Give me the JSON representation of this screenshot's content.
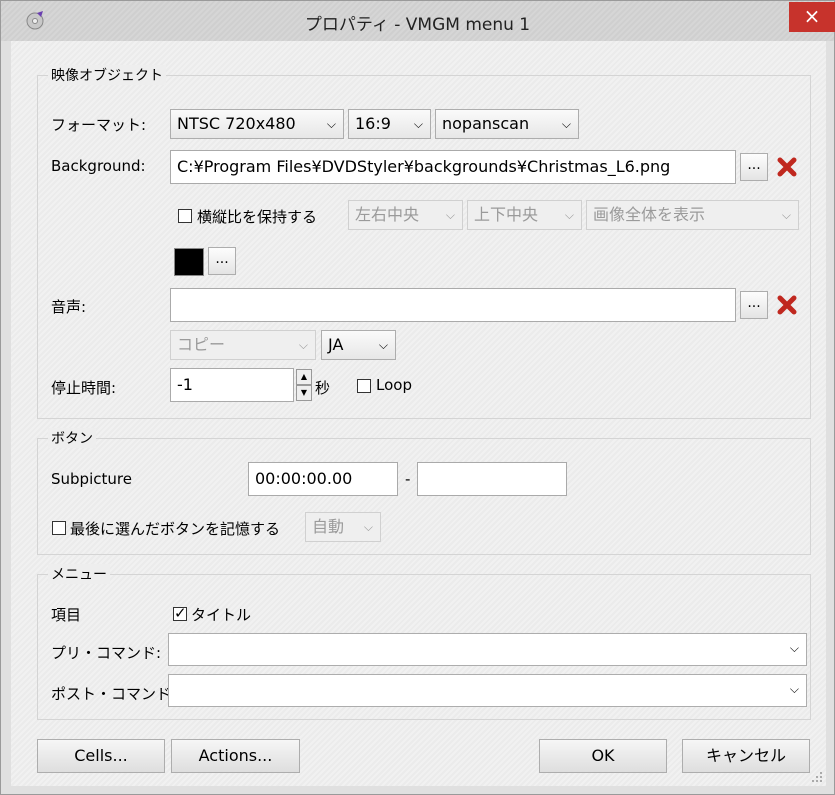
{
  "window": {
    "title": "プロパティ - VMGM menu 1",
    "close": "×"
  },
  "video": {
    "group_title": "映像オブジェクト",
    "format_label": "フォーマット:",
    "format_value": "NTSC 720x480",
    "aspect_value": "16:9",
    "scan_value": "nopanscan",
    "background_label": "Background:",
    "background_value": "C:¥Program Files¥DVDStyler¥backgrounds¥Christmas_L6.png",
    "browse_label": "...",
    "keep_aspect_label": "横縦比を保持する",
    "halign_value": "左右中央",
    "valign_value": "上下中央",
    "fit_value": "画像全体を表示",
    "color_value": "#000000",
    "audio_label": "音声:",
    "audio_value": "",
    "copy_value": "コピー",
    "lang_value": "JA",
    "pause_label": "停止時間:",
    "pause_value": "-1",
    "seconds_label": "秒",
    "loop_label": "Loop"
  },
  "buttons": {
    "group_title": "ボタン",
    "subpicture_label": "Subpicture",
    "start_value": "00:00:00.00",
    "dash": "-",
    "end_value": "",
    "remember_label": "最後に選んだボタンを記憶する",
    "auto_value": "自動"
  },
  "menu": {
    "group_title": "メニュー",
    "item_label": "項目",
    "title_check_label": "タイトル",
    "pre_label": "プリ・コマンド:",
    "pre_value": "",
    "post_label": "ポスト・コマンド:",
    "post_value": ""
  },
  "footer": {
    "cells": "Cells...",
    "actions": "Actions...",
    "ok": "OK",
    "cancel": "キャンセル"
  }
}
